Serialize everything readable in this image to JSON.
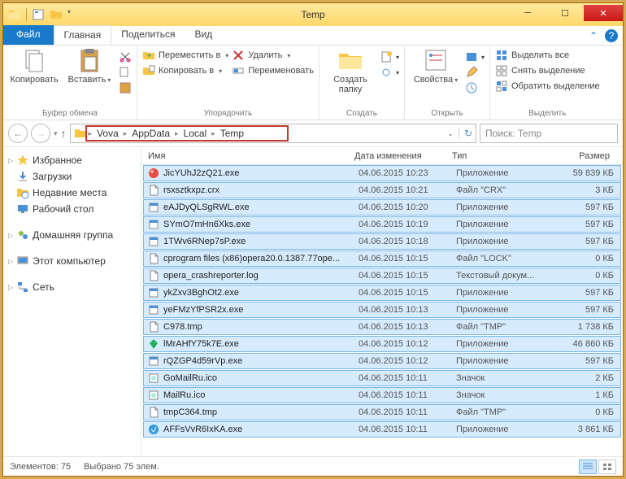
{
  "title": "Temp",
  "tabs": {
    "file": "Файл",
    "home": "Главная",
    "share": "Поделиться",
    "view": "Вид"
  },
  "ribbon": {
    "clipboard": {
      "copy": "Копировать",
      "paste": "Вставить",
      "label": "Буфер обмена"
    },
    "organize": {
      "moveto": "Переместить в",
      "copyto": "Копировать в",
      "delete": "Удалить",
      "rename": "Переименовать",
      "label": "Упорядочить"
    },
    "new": {
      "folder": "Создать\nпапку",
      "label": "Создать"
    },
    "open": {
      "props": "Свойства",
      "label": "Открыть"
    },
    "select": {
      "all": "Выделить все",
      "none": "Снять выделение",
      "invert": "Обратить выделение",
      "label": "Выделить"
    }
  },
  "breadcrumbs": [
    "Vova",
    "AppData",
    "Local",
    "Temp"
  ],
  "search_placeholder": "Поиск: Temp",
  "nav": {
    "favorites": "Избранное",
    "downloads": "Загрузки",
    "recent": "Недавние места",
    "desktop": "Рабочий стол",
    "homegroup": "Домашняя группа",
    "thispc": "Этот компьютер",
    "network": "Сеть"
  },
  "columns": {
    "name": "Имя",
    "date": "Дата изменения",
    "type": "Тип",
    "size": "Размер"
  },
  "files": [
    {
      "icon": "app-ball",
      "name": "JicYUhJ2zQ21.exe",
      "date": "04.06.2015 10:23",
      "type": "Приложение",
      "size": "59 839 КБ"
    },
    {
      "icon": "file",
      "name": "rsxsztkxpz.crx",
      "date": "04.06.2015 10:21",
      "type": "Файл \"CRX\"",
      "size": "3 КБ"
    },
    {
      "icon": "app",
      "name": "eAJDyQLSgRWL.exe",
      "date": "04.06.2015 10:20",
      "type": "Приложение",
      "size": "597 КБ"
    },
    {
      "icon": "app",
      "name": "SYmO7mHn6Xks.exe",
      "date": "04.06.2015 10:19",
      "type": "Приложение",
      "size": "597 КБ"
    },
    {
      "icon": "app",
      "name": "1TWv6RNep7sP.exe",
      "date": "04.06.2015 10:18",
      "type": "Приложение",
      "size": "597 КБ"
    },
    {
      "icon": "file",
      "name": "cprogram files (x86)opera20.0.1387.77ope...",
      "date": "04.06.2015 10:15",
      "type": "Файл \"LOCK\"",
      "size": "0 КБ"
    },
    {
      "icon": "file",
      "name": "opera_crashreporter.log",
      "date": "04.06.2015 10:15",
      "type": "Текстовый докум...",
      "size": "0 КБ"
    },
    {
      "icon": "app",
      "name": "ykZxv3BghOt2.exe",
      "date": "04.06.2015 10:15",
      "type": "Приложение",
      "size": "597 КБ"
    },
    {
      "icon": "app",
      "name": "yeFMzYfPSR2x.exe",
      "date": "04.06.2015 10:13",
      "type": "Приложение",
      "size": "597 КБ"
    },
    {
      "icon": "file",
      "name": "C978.tmp",
      "date": "04.06.2015 10:13",
      "type": "Файл \"TMP\"",
      "size": "1 738 КБ"
    },
    {
      "icon": "app-green",
      "name": "lMrAHfY75k7E.exe",
      "date": "04.06.2015 10:12",
      "type": "Приложение",
      "size": "46 860 КБ"
    },
    {
      "icon": "app",
      "name": "rQZGP4d59rVp.exe",
      "date": "04.06.2015 10:12",
      "type": "Приложение",
      "size": "597 КБ"
    },
    {
      "icon": "icon",
      "name": "GoMailRu.ico",
      "date": "04.06.2015 10:11",
      "type": "Значок",
      "size": "2 КБ"
    },
    {
      "icon": "icon",
      "name": "MailRu.ico",
      "date": "04.06.2015 10:11",
      "type": "Значок",
      "size": "1 КБ"
    },
    {
      "icon": "file",
      "name": "tmpC364.tmp",
      "date": "04.06.2015 10:11",
      "type": "Файл \"TMP\"",
      "size": "0 КБ"
    },
    {
      "icon": "app-blue",
      "name": "AFFsVvR6IxKA.exe",
      "date": "04.06.2015 10:11",
      "type": "Приложение",
      "size": "3 861 КБ"
    }
  ],
  "status": {
    "count": "Элементов: 75",
    "selected": "Выбрано 75 элем."
  }
}
